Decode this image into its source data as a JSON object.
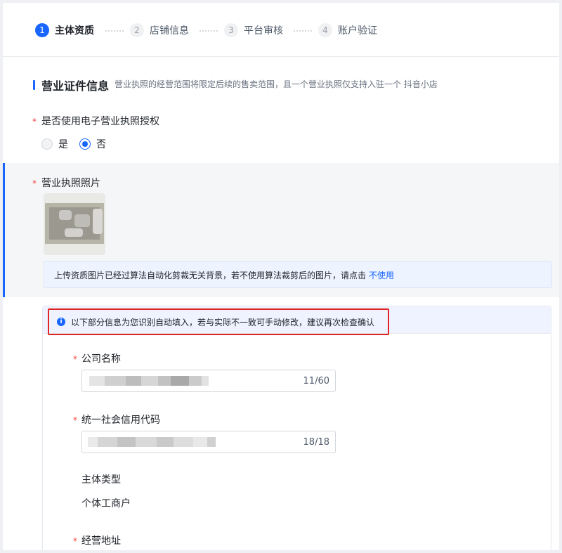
{
  "steps": [
    {
      "num": "1",
      "label": "主体资质",
      "active": true
    },
    {
      "num": "2",
      "label": "店铺信息",
      "active": false
    },
    {
      "num": "3",
      "label": "平台审核",
      "active": false
    },
    {
      "num": "4",
      "label": "账户验证",
      "active": false
    }
  ],
  "section": {
    "title": "营业证件信息",
    "desc": "营业执照的经营范围将限定后续的售卖范围，且一个营业执照仅支持入驻一个 抖音小店"
  },
  "e_license": {
    "required_mark": "*",
    "label": "是否使用电子营业执照授权",
    "options": [
      {
        "label": "是",
        "checked": false
      },
      {
        "label": "否",
        "checked": true
      }
    ]
  },
  "license_photo": {
    "required_mark": "*",
    "label": "营业执照照片",
    "tip_text": "上传资质图片已经过算法自动化剪裁无关背景，若不使用算法裁剪后的图片，请点击",
    "tip_link": "不使用"
  },
  "recognized": {
    "notice_icon": "i",
    "notice": "以下部分信息为您识别自动填入，若与实际不一致可手动修改，建议再次检查确认",
    "company_name": {
      "required_mark": "*",
      "label": "公司名称",
      "count": "11/60"
    },
    "credit_code": {
      "required_mark": "*",
      "label": "统一社会信用代码",
      "count": "18/18"
    },
    "entity_type": {
      "label": "主体类型",
      "value": "个体工商户"
    },
    "address": {
      "required_mark": "*",
      "label": "经营地址"
    }
  },
  "colors": {
    "accent": "#1966ff",
    "required": "#f53f3f",
    "notice_border": "#e02424"
  }
}
